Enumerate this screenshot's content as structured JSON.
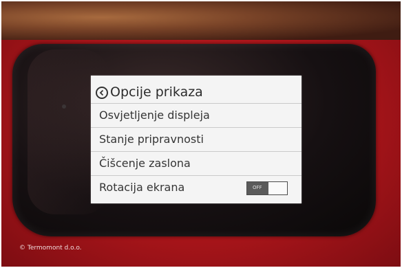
{
  "screen": {
    "title": "Opcije prikaza",
    "back_icon": "back-arrow-circle-icon",
    "items": [
      {
        "label": "Osvjetljenje displeja"
      },
      {
        "label": "Stanje pripravnosti"
      },
      {
        "label": "Čišcenje zaslona"
      },
      {
        "label": "Rotacija ekrana",
        "toggle": "OFF"
      }
    ]
  },
  "watermark": "© Termomont d.o.o.",
  "colors": {
    "device_red": "#b3171c",
    "bezel": "#161012",
    "screen_bg": "#f4f4f4",
    "toggle_off": "#5a5a5a"
  }
}
